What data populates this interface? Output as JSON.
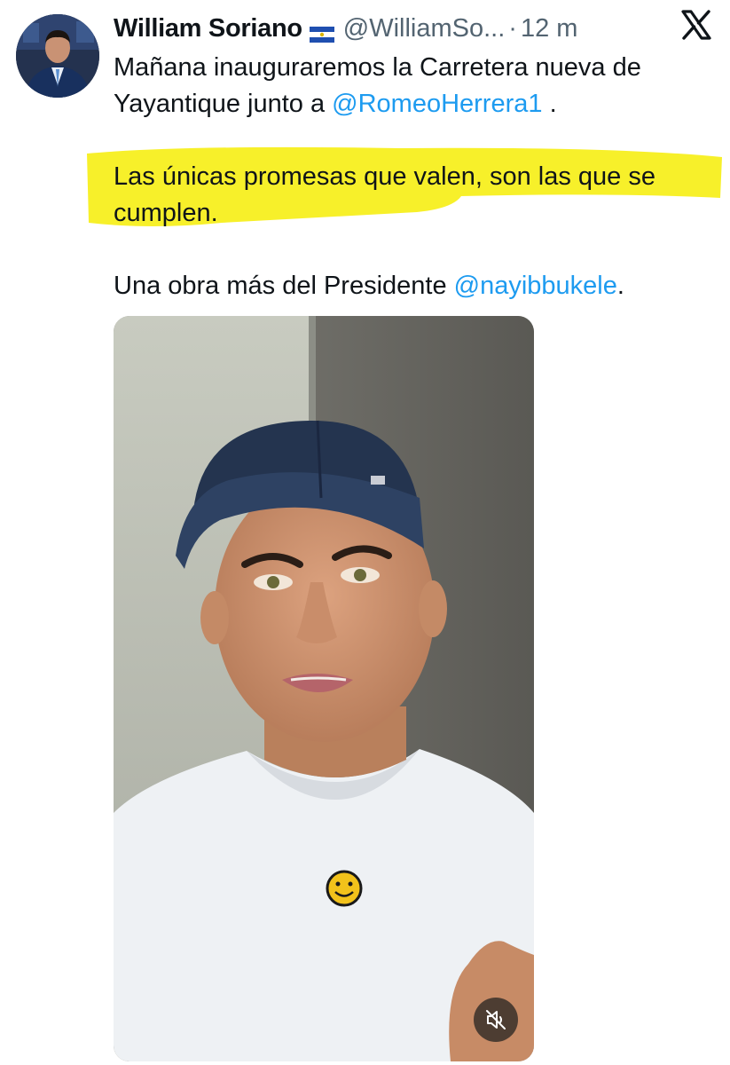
{
  "tweet": {
    "author_name": "William Soriano",
    "author_handle": "@WilliamSo...",
    "separator": "·",
    "time": "12 m",
    "line1_text": "Mañana inauguraremos la Carretera nueva de Yayantique junto a ",
    "line1_mention": "@RomeoHerrera1",
    "line1_end": " .",
    "quote_text": "Las únicas promesas que valen, son las que se cumplen.",
    "line3_text": "Una obra más del Presidente ",
    "line3_mention": "@nayibbukele",
    "line3_end": "."
  },
  "icons": {
    "flag": "el-salvador-flag-icon",
    "platform": "x-logo-icon",
    "mute": "muted-speaker-icon"
  },
  "colors": {
    "mention": "#1d9bf0",
    "muted_text": "#536471",
    "highlight": "#f7f01d"
  }
}
